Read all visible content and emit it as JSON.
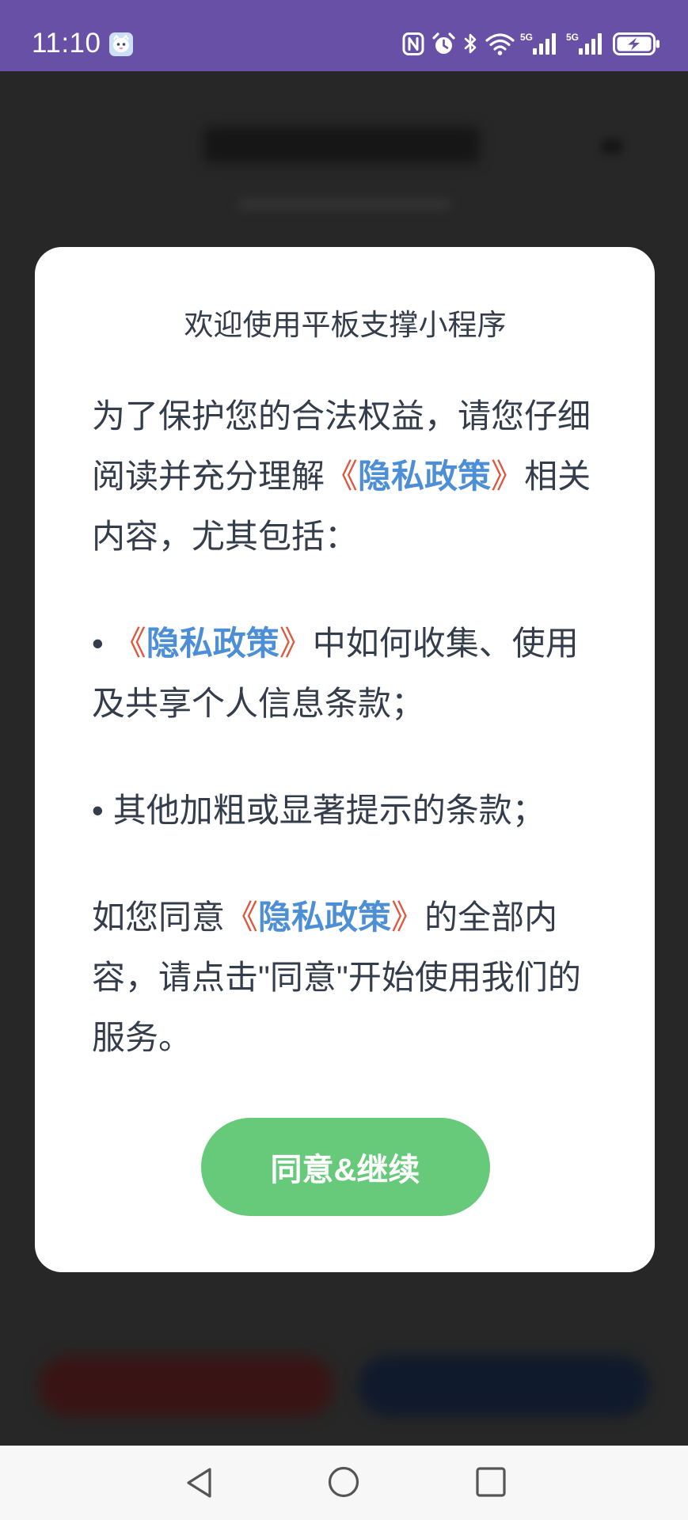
{
  "status_bar": {
    "time": "11:10",
    "signal_1_label": "5G",
    "signal_2_label": "5G",
    "icons": {
      "app": "app-notification-icon",
      "nfc": "nfc-icon",
      "alarm": "alarm-icon",
      "bluetooth": "bluetooth-icon",
      "wifi": "wifi-icon",
      "signal_1": "cellular-signal-icon",
      "signal_2": "cellular-signal-icon",
      "battery": "battery-charging-icon"
    }
  },
  "privacy_dialog": {
    "title": "欢迎使用平板支撑小程序",
    "policy_link": {
      "open": "《",
      "text": "隐私政策",
      "close": "》"
    },
    "intro": {
      "before_link": "为了保护您的合法权益，请您仔细阅读并充分理解",
      "after_link": "相关内容，尤其包括："
    },
    "bullet": "•",
    "bullet_1_after_link": "中如何收集、使用及共享个人信息条款；",
    "bullet_2": "其他加粗或显著提示的条款；",
    "closing": {
      "before_link": "如您同意",
      "after_link": "的全部内容，请点击\"同意\"开始使用我们的服务。"
    },
    "agree_button_label": "同意&继续"
  },
  "nav_bar": {
    "icons": {
      "back": "back-icon",
      "home": "home-icon",
      "recents": "recents-icon"
    }
  },
  "colors": {
    "status_bar": "#6750a5",
    "overlay": "#272727",
    "dialog_background": "#ffffff",
    "body_text": "#333d4b",
    "link_bracket": "#e0573f",
    "link_text": "#4d8fd6",
    "agree_button": "#66ca7a",
    "nav_bar_background": "#f7f7f7"
  }
}
